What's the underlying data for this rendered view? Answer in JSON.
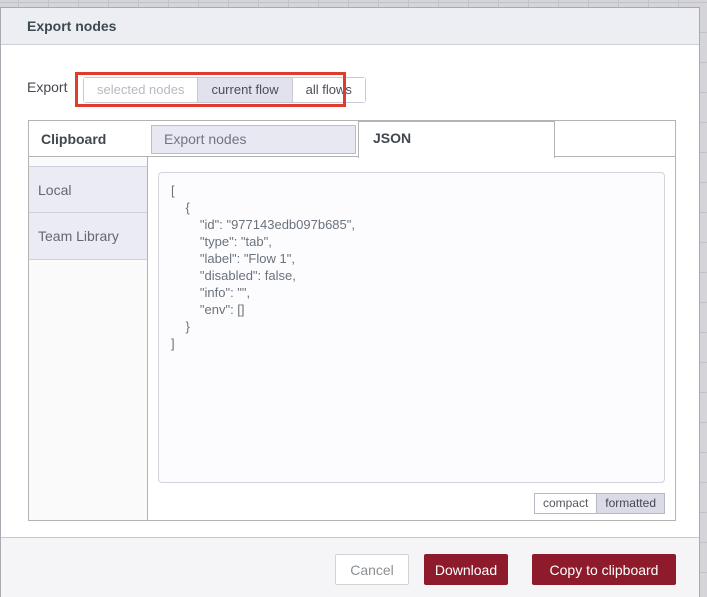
{
  "colors": {
    "primary_button": "#8e1b2b",
    "annotation_red": "#e03b2e",
    "selected_lavender": "#e2e2ef",
    "header_bg": "#ededf4"
  },
  "dialog": {
    "title": "Export nodes"
  },
  "export_scope": {
    "label": "Export",
    "options": [
      {
        "label": "selected nodes",
        "state": "disabled"
      },
      {
        "label": "current flow",
        "state": "selected"
      },
      {
        "label": "all flows",
        "state": "normal"
      }
    ]
  },
  "tabs": {
    "clipboard": "Clipboard",
    "items": [
      {
        "label": "Export nodes",
        "active": false
      },
      {
        "label": "JSON",
        "active": true
      }
    ]
  },
  "sidebar": {
    "items": [
      {
        "label": "Local"
      },
      {
        "label": "Team Library"
      }
    ]
  },
  "editor": {
    "content": "[\n    {\n        \"id\": \"977143edb097b685\",\n        \"type\": \"tab\",\n        \"label\": \"Flow 1\",\n        \"disabled\": false,\n        \"info\": \"\",\n        \"env\": []\n    }\n]"
  },
  "format_toggle": {
    "options": [
      {
        "label": "compact",
        "selected": false
      },
      {
        "label": "formatted",
        "selected": true
      }
    ]
  },
  "footer": {
    "buttons": [
      {
        "label": "Cancel",
        "style": "secondary"
      },
      {
        "label": "Download",
        "style": "primary"
      },
      {
        "label": "Copy to clipboard",
        "style": "primary"
      }
    ]
  }
}
